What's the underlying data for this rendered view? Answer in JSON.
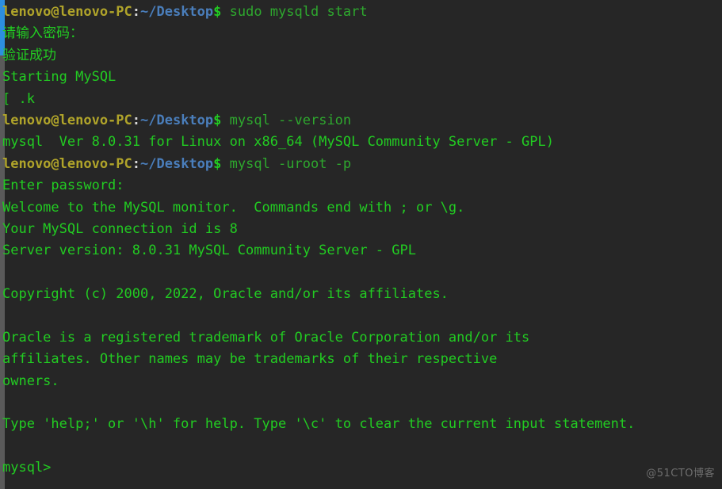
{
  "terminal": {
    "background_color": "#262626",
    "default_text_color": "#22cc22",
    "prompt": {
      "user_host": "lenovo@lenovo-PC",
      "separator": ":",
      "path": "~/Desktop",
      "symbol": "$",
      "user_host_color": "#b0a42a",
      "path_color": "#4a7ebb",
      "symbol_color": "#22cc22"
    },
    "scrollbar": {
      "track_color": "#5a5a5a",
      "thumb_color": "#2d8fe0"
    },
    "lines": [
      {
        "type": "prompt",
        "command": "sudo mysqld start"
      },
      {
        "type": "output",
        "text": "请输入密码：",
        "lang": "cn"
      },
      {
        "type": "output",
        "text": "验证成功",
        "lang": "cn"
      },
      {
        "type": "output",
        "text": "Starting MySQL"
      },
      {
        "type": "output",
        "text": "[ .k"
      },
      {
        "type": "prompt",
        "command": "mysql --version"
      },
      {
        "type": "output",
        "text": "mysql  Ver 8.0.31 for Linux on x86_64 (MySQL Community Server - GPL)"
      },
      {
        "type": "prompt",
        "command": "mysql -uroot -p"
      },
      {
        "type": "output",
        "text": "Enter password:"
      },
      {
        "type": "output",
        "text": "Welcome to the MySQL monitor.  Commands end with ; or \\g."
      },
      {
        "type": "output",
        "text": "Your MySQL connection id is 8"
      },
      {
        "type": "output",
        "text": "Server version: 8.0.31 MySQL Community Server - GPL"
      },
      {
        "type": "blank",
        "text": ""
      },
      {
        "type": "output",
        "text": "Copyright (c) 2000, 2022, Oracle and/or its affiliates."
      },
      {
        "type": "blank",
        "text": ""
      },
      {
        "type": "output",
        "text": "Oracle is a registered trademark of Oracle Corporation and/or its"
      },
      {
        "type": "output",
        "text": "affiliates. Other names may be trademarks of their respective"
      },
      {
        "type": "output",
        "text": "owners."
      },
      {
        "type": "blank",
        "text": ""
      },
      {
        "type": "output",
        "text": "Type 'help;' or '\\h' for help. Type '\\c' to clear the current input statement."
      },
      {
        "type": "blank",
        "text": ""
      },
      {
        "type": "mysql_prompt",
        "text": "mysql>"
      }
    ]
  },
  "watermark": {
    "text": "@51CTO博客",
    "color": "#6e6e6e"
  }
}
